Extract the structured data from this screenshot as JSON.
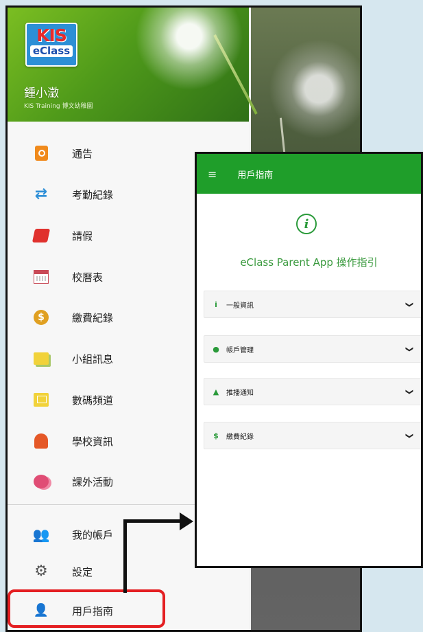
{
  "drawer": {
    "logo": {
      "line1": "KIS",
      "line2": "eClass"
    },
    "user_name": "鍾小澂",
    "school": "KIS Training 博文幼稚園",
    "items": [
      {
        "label": "通告",
        "icon": "notice-icon"
      },
      {
        "label": "考勤紀錄",
        "icon": "attendance-arrows-icon"
      },
      {
        "label": "請假",
        "icon": "leave-icon"
      },
      {
        "label": "校曆表",
        "icon": "calendar-icon"
      },
      {
        "label": "繳費紀錄",
        "icon": "payment-icon"
      },
      {
        "label": "小組訊息",
        "icon": "group-message-icon"
      },
      {
        "label": "數碼頻道",
        "icon": "digital-channel-icon"
      },
      {
        "label": "學校資訊",
        "icon": "school-info-icon"
      },
      {
        "label": "課外活動",
        "icon": "extra-activity-icon"
      }
    ],
    "bottom_items": [
      {
        "label": "我的帳戶",
        "icon": "account-icon"
      },
      {
        "label": "設定",
        "icon": "settings-gear-icon"
      },
      {
        "label": "用戶指南",
        "icon": "user-guide-icon"
      }
    ]
  },
  "guide": {
    "menu_symbol": "≡",
    "bar_title": "用戶指南",
    "info_symbol": "i",
    "title": "eClass Parent App 操作指引",
    "sections": [
      {
        "label": "一般資訊",
        "icon_symbol": "i",
        "chevron": "❯"
      },
      {
        "label": "帳戶管理",
        "icon_symbol": "●",
        "chevron": "❯"
      },
      {
        "label": "推播通知",
        "icon_symbol": "▲",
        "chevron": "❯"
      },
      {
        "label": "繳費紀錄",
        "icon_symbol": "$",
        "chevron": "❯"
      }
    ]
  },
  "colors": {
    "accent_green": "#1f9e2a",
    "highlight_red": "#e41f22",
    "page_background": "#d6e7ef"
  }
}
